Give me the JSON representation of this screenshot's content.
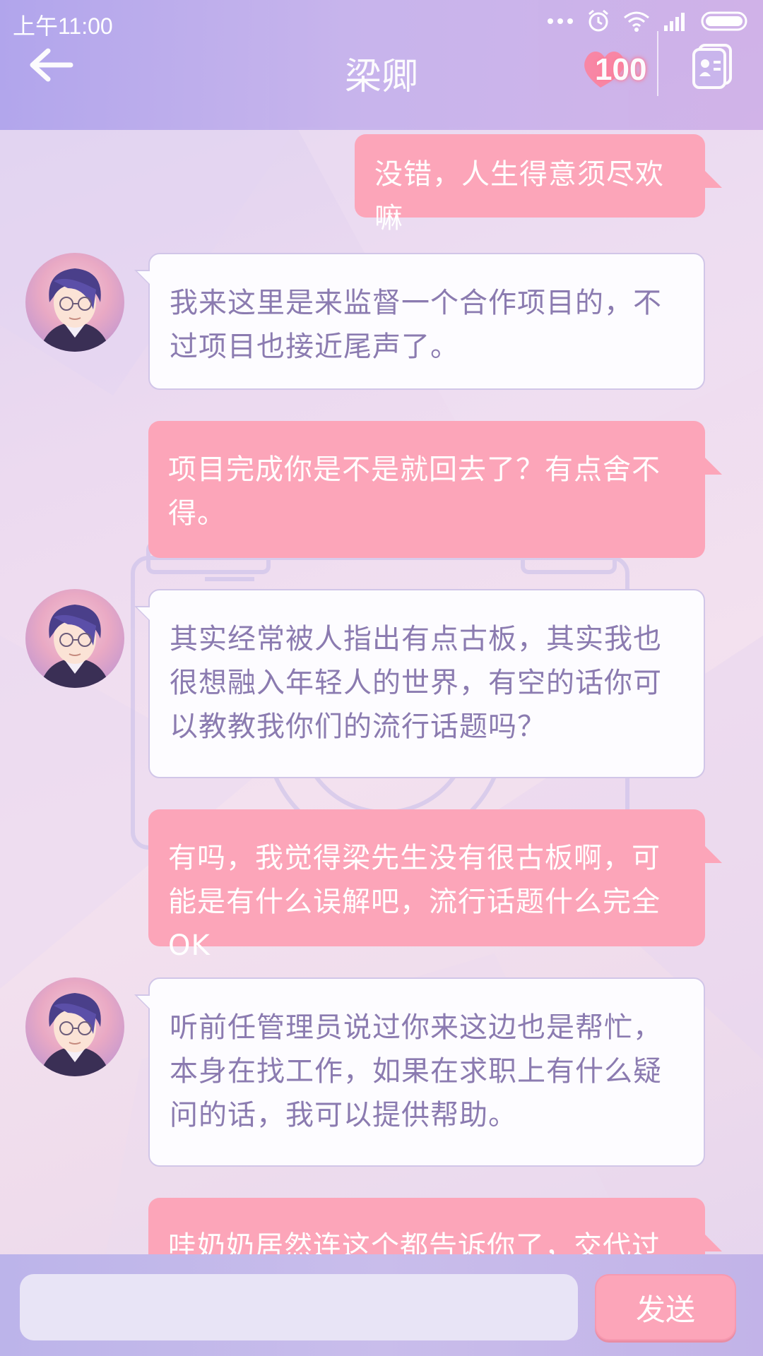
{
  "status_bar": {
    "time": "上午11:00",
    "icons": [
      "more-dots-icon",
      "alarm-icon",
      "wifi-icon",
      "signal-icon",
      "battery-icon"
    ]
  },
  "header": {
    "title": "梁卿",
    "heart_count": "100",
    "back_icon": "back-arrow-icon",
    "profile_icon": "profile-card-icon"
  },
  "messages": [
    {
      "side": "right",
      "text": "没错，人生得意须尽欢嘛"
    },
    {
      "side": "left",
      "avatar": "avatar",
      "text": "我来这里是来监督一个合作项目的，不过项目也接近尾声了。"
    },
    {
      "side": "right",
      "text": "项目完成你是不是就回去了？有点舍不得。"
    },
    {
      "side": "left",
      "avatar": "avatar",
      "text": "其实经常被人指出有点古板，其实我也很想融入年轻人的世界，有空的话你可以教教我你们的流行话题吗？"
    },
    {
      "side": "right",
      "text": "有吗，我觉得梁先生没有很古板啊，可能是有什么误解吧，流行话题什么完全OK"
    },
    {
      "side": "left",
      "avatar": "avatar",
      "text": "听前任管理员说过你来这边也是帮忙，本身在找工作，如果在求职上有什么疑问的话，我可以提供帮助。"
    },
    {
      "side": "right",
      "text": "哇奶奶居然连这个都告诉你了，交代过她"
    }
  ],
  "input": {
    "value": "",
    "placeholder": "",
    "send_label": "发送"
  },
  "colors": {
    "header": "#b8a8ec",
    "bubble_right": "#fca5b9",
    "bubble_left_text": "#8b7bb0",
    "heart": "#ff7b97"
  }
}
